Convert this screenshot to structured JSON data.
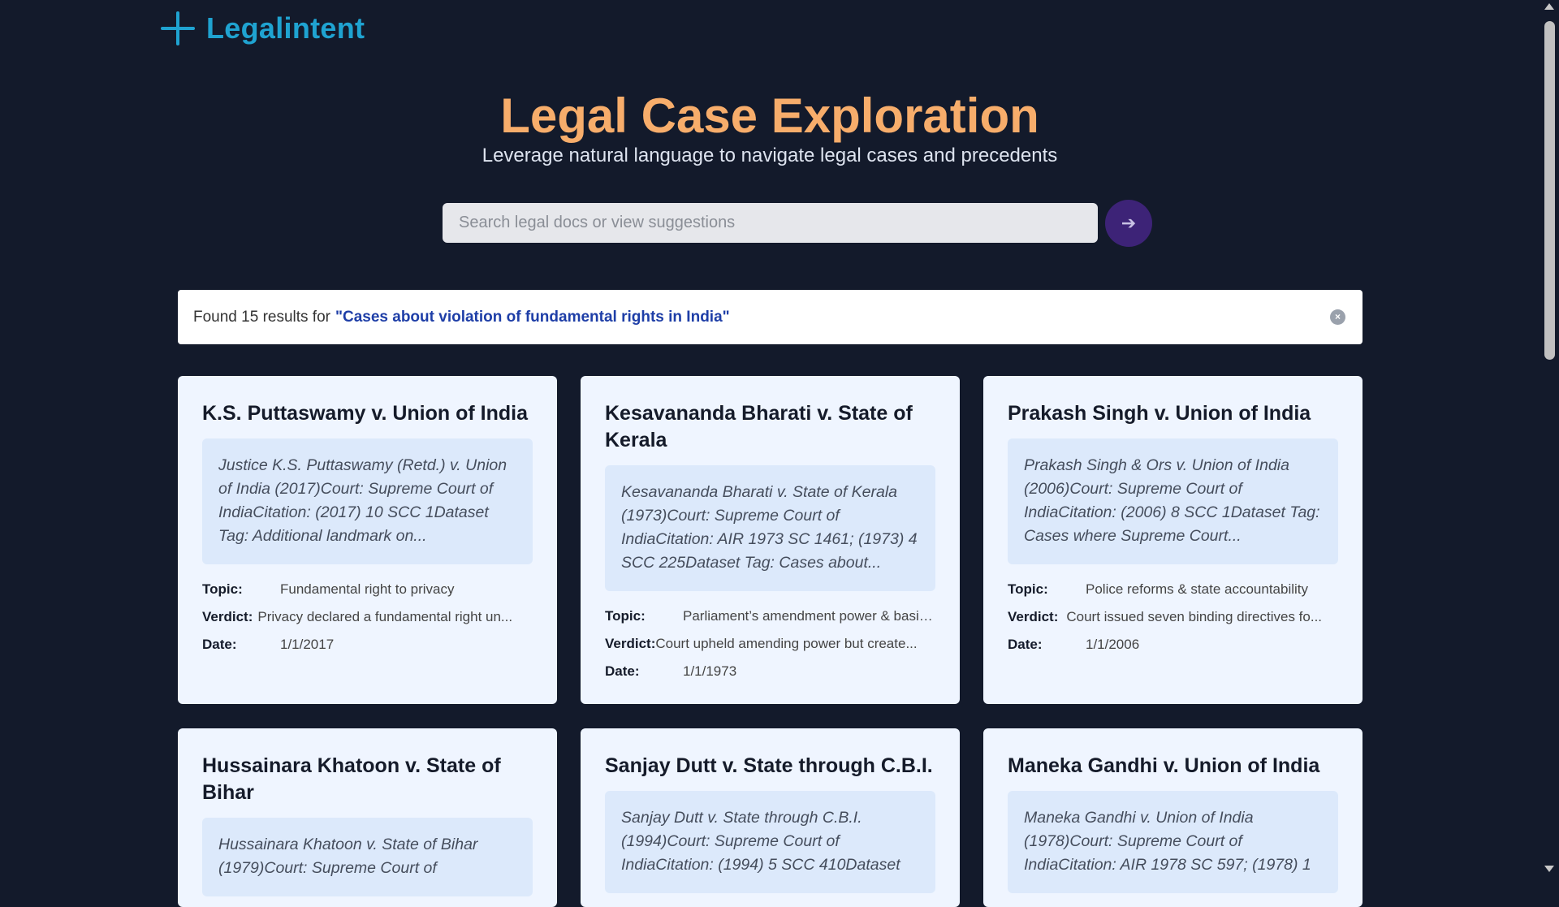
{
  "brand": {
    "name": "Legalintent"
  },
  "hero": {
    "title": "Legal Case Exploration",
    "subtitle": "Leverage natural language to navigate legal cases and precedents"
  },
  "search": {
    "placeholder": "Search legal docs or view suggestions",
    "button_icon": "arrow-right-icon"
  },
  "results": {
    "prefix": "Found 15 results for",
    "query": "\"Cases about violation of fundamental rights in India\"",
    "clear_icon": "close-circle-icon"
  },
  "labels": {
    "topic": "Topic:",
    "verdict": "Verdict:",
    "date": "Date:"
  },
  "cards": [
    {
      "title": "K.S. Puttaswamy v. Union of India",
      "summary": "Justice K.S. Puttaswamy (Retd.) v. Union of India (2017)Court: Supreme Court of IndiaCitation: (2017) 10 SCC 1Dataset Tag: Additional landmark on...",
      "topic": "Fundamental right to privacy",
      "verdict": "Privacy declared a fundamental right un...",
      "date": "1/1/2017"
    },
    {
      "title": "Kesavananda Bharati v. State of Kerala",
      "summary": "Kesavananda Bharati v. State of Kerala (1973)Court: Supreme Court of IndiaCitation: AIR 1973 SC 1461; (1973) 4 SCC 225Dataset Tag: Cases about...",
      "topic": "Parliament’s amendment power & basic-...",
      "verdict": "Court upheld amending power but create...",
      "date": "1/1/1973"
    },
    {
      "title": "Prakash Singh v. Union of India",
      "summary": "Prakash Singh & Ors v. Union of India (2006)Court: Supreme Court of IndiaCitation: (2006) 8 SCC 1Dataset Tag: Cases where Supreme Court...",
      "topic": "Police reforms & state accountability",
      "verdict": "Court issued seven binding directives fo...",
      "date": "1/1/2006"
    },
    {
      "title": "Hussainara Khatoon v. State of Bihar",
      "summary": "Hussainara Khatoon v. State of Bihar (1979)Court: Supreme Court of",
      "topic": "",
      "verdict": "",
      "date": ""
    },
    {
      "title": "Sanjay Dutt v. State through C.B.I.",
      "summary": "Sanjay Dutt v. State through C.B.I. (1994)Court: Supreme Court of IndiaCitation: (1994) 5 SCC 410Dataset",
      "topic": "",
      "verdict": "",
      "date": ""
    },
    {
      "title": "Maneka Gandhi v. Union of India",
      "summary": "Maneka Gandhi v. Union of India (1978)Court: Supreme Court of IndiaCitation: AIR 1978 SC 597; (1978) 1",
      "topic": "",
      "verdict": "",
      "date": ""
    }
  ],
  "colors": {
    "background": "#131a2b",
    "brand": "#1fa3d1",
    "title": "#f7ad6b",
    "search_button": "#3d2377",
    "query_text": "#1e3ea7",
    "card_bg": "#eff5ff",
    "summary_bg": "#dce9fb"
  }
}
